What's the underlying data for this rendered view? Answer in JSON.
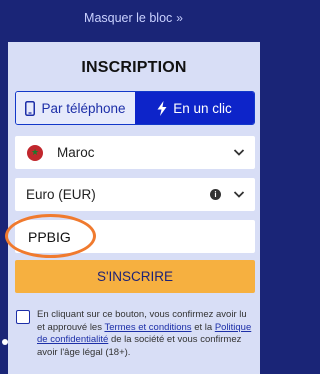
{
  "header": {
    "hide_label": "Masquer le bloc",
    "hide_icon": "double-chevron-right-icon"
  },
  "form": {
    "title": "INSCRIPTION",
    "tabs": [
      {
        "label": "Par téléphone",
        "icon": "phone-icon",
        "active": false
      },
      {
        "label": "En un clic",
        "icon": "lightning-icon",
        "active": true
      }
    ],
    "country": {
      "value": "Maroc",
      "flag": "morocco-flag-icon"
    },
    "currency": {
      "value": "Euro (EUR)"
    },
    "promo_code": {
      "value": "PPBIG"
    },
    "submit_label": "S'INSCRIRE",
    "consent": {
      "part1": "En cliquant sur ce bouton, vous confirmez avoir lu et approuvé les ",
      "terms_link": "Termes et conditions",
      "part2": " et la ",
      "privacy_link": "Politique de confidentialité",
      "part3": " de la société et vous confirmez avoir l'âge légal (18+).",
      "checked": false
    }
  },
  "colors": {
    "page_bg": "#1a2577",
    "panel_bg": "#d8def6",
    "active_tab": "#0d24c9",
    "submit_bg": "#f6b040",
    "highlight_oval": "#f07a2e"
  }
}
